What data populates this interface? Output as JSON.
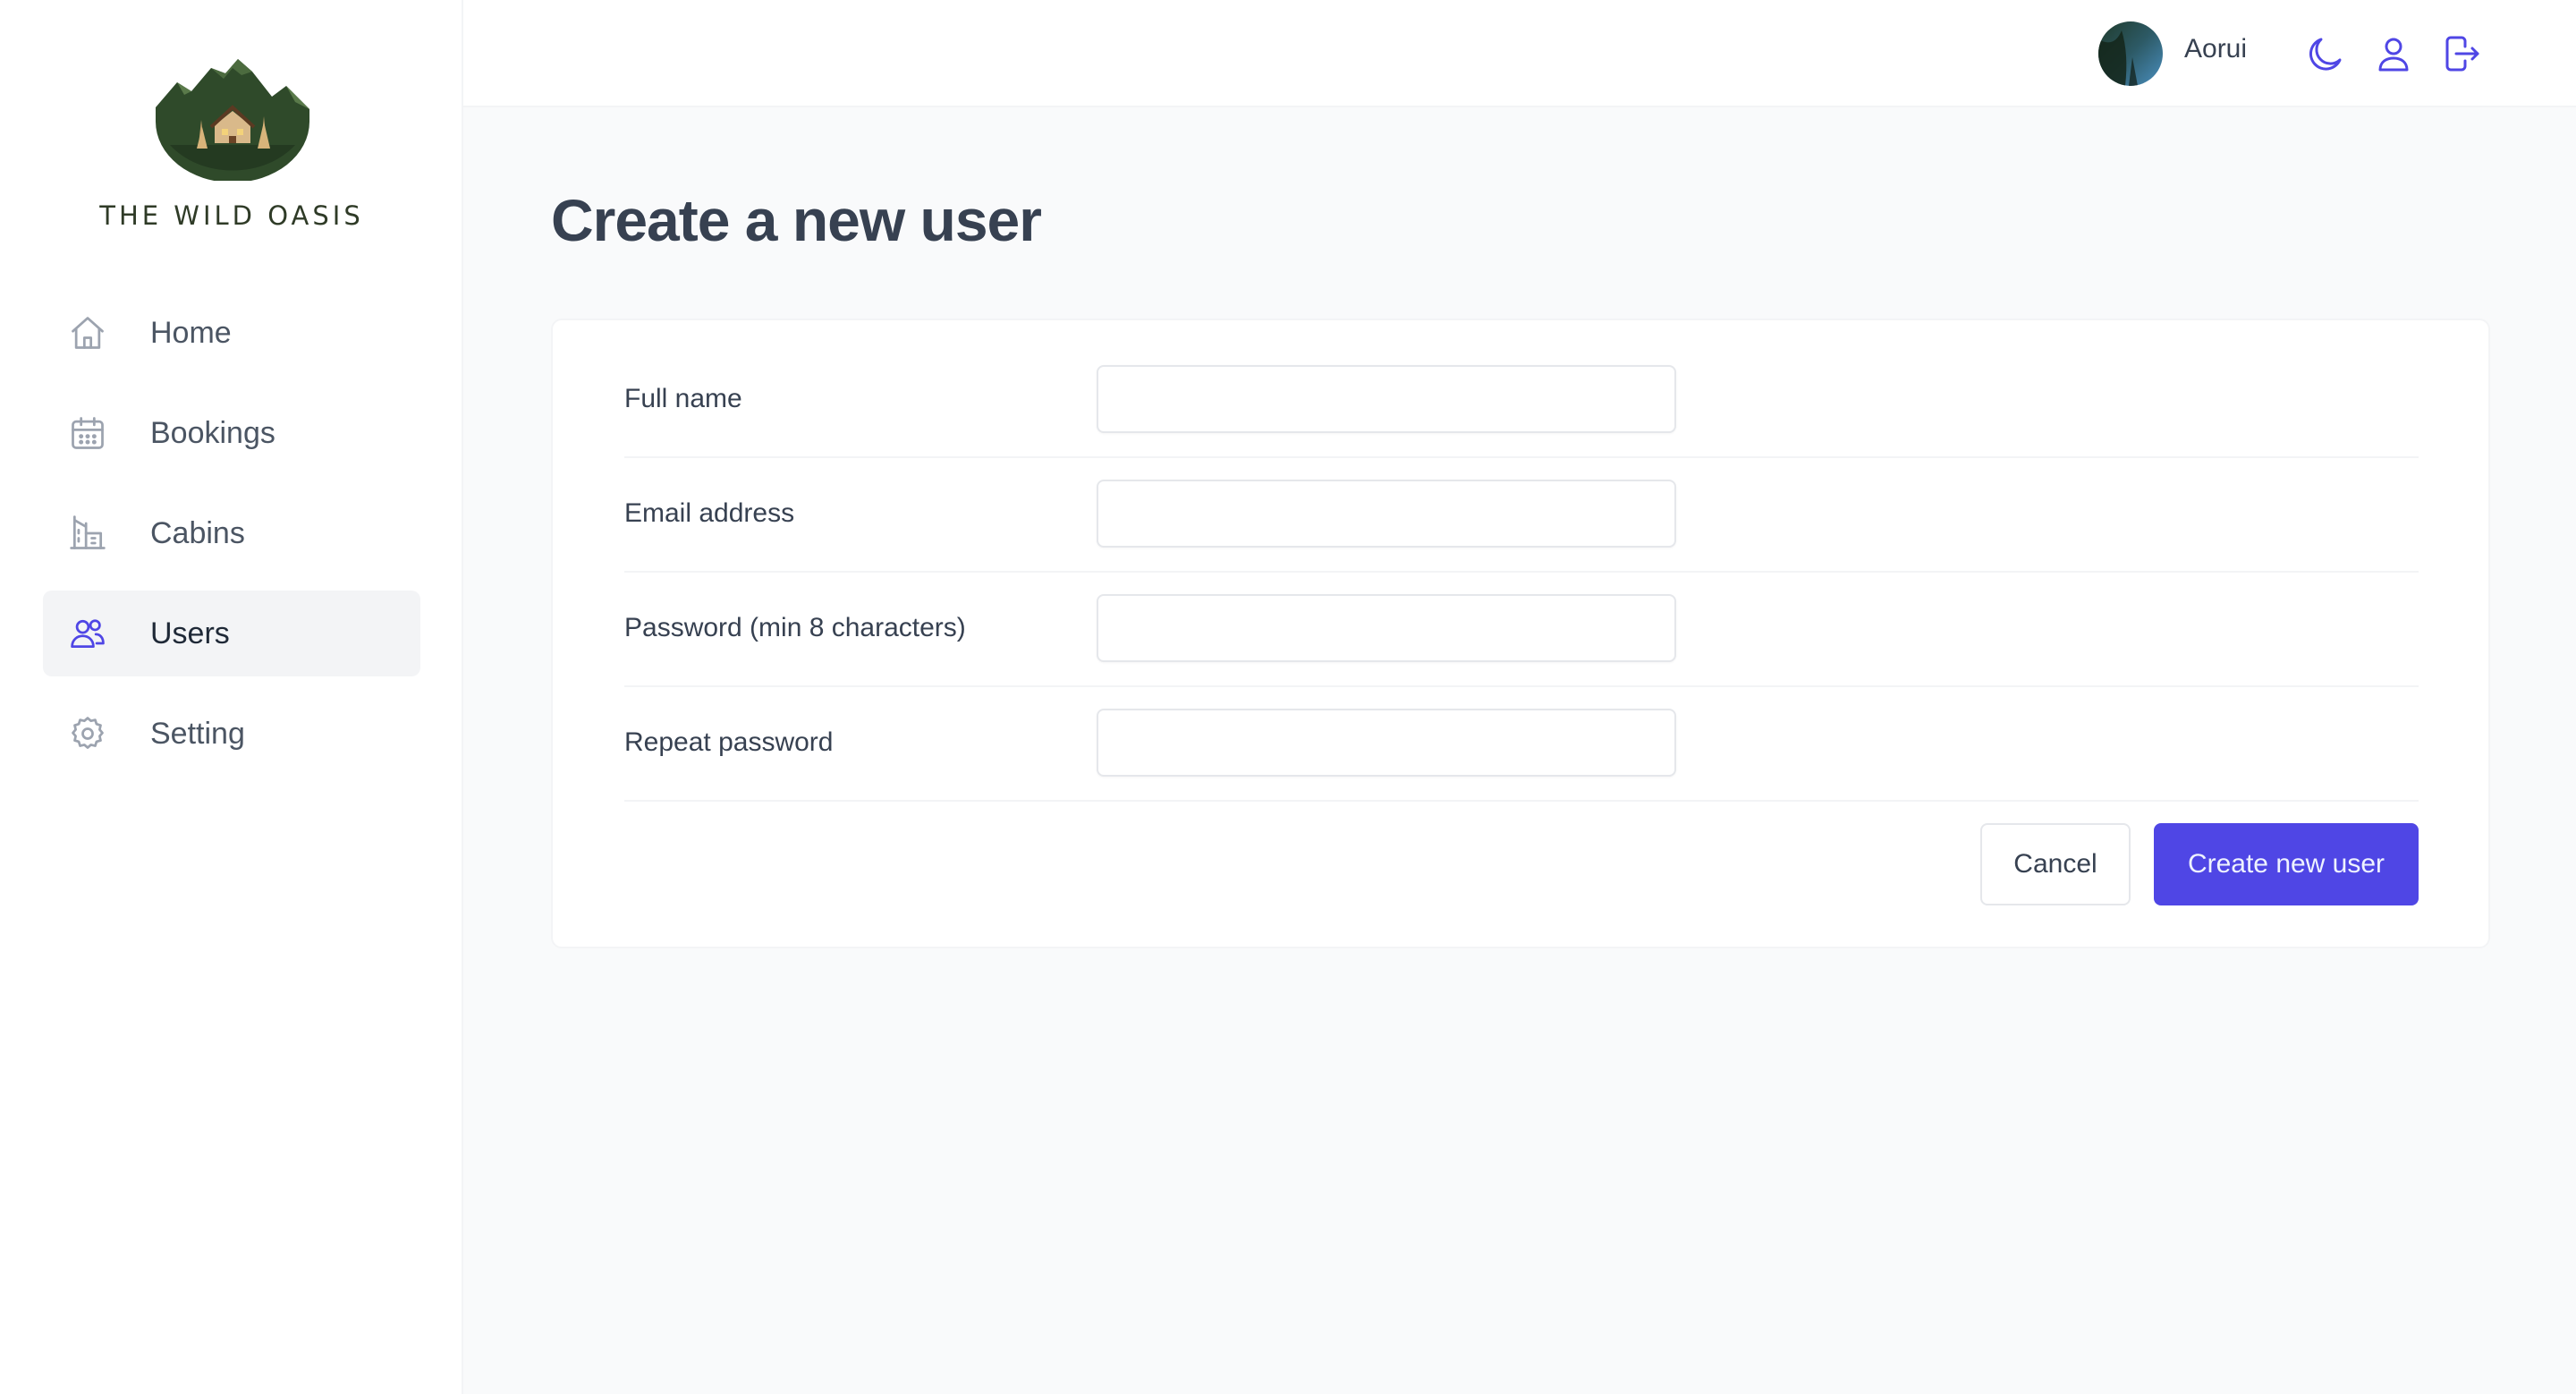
{
  "brand": {
    "name": "THE WILD OASIS"
  },
  "sidebar": {
    "items": [
      {
        "label": "Home",
        "icon": "home-icon"
      },
      {
        "label": "Bookings",
        "icon": "calendar-icon"
      },
      {
        "label": "Cabins",
        "icon": "cabin-icon"
      },
      {
        "label": "Users",
        "icon": "users-icon"
      },
      {
        "label": "Setting",
        "icon": "gear-icon"
      }
    ],
    "active": "Users"
  },
  "header": {
    "username": "Aorui",
    "actions": [
      "moon-icon",
      "user-icon",
      "logout-icon"
    ]
  },
  "page": {
    "title": "Create a new user"
  },
  "form": {
    "fields": [
      {
        "label": "Full name",
        "value": ""
      },
      {
        "label": "Email address",
        "value": ""
      },
      {
        "label": "Password (min 8 characters)",
        "value": ""
      },
      {
        "label": "Repeat password",
        "value": ""
      }
    ],
    "cancel_label": "Cancel",
    "submit_label": "Create new user"
  },
  "colors": {
    "accent": "#4f46e5",
    "background": "#f9fafb",
    "surface": "#ffffff",
    "text": "#374151"
  }
}
